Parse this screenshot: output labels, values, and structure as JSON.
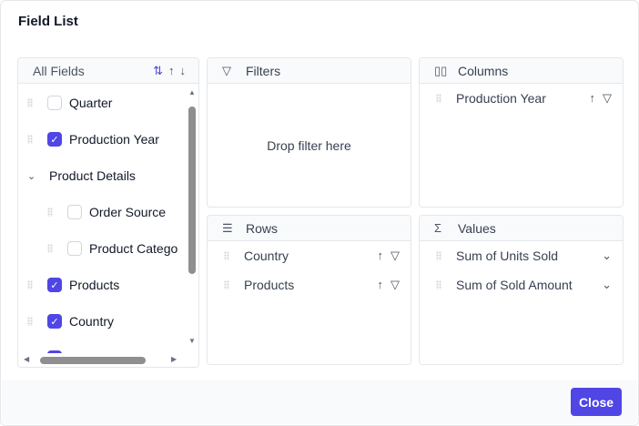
{
  "dialog": {
    "title": "Field List",
    "close_label": "Close"
  },
  "all_fields": {
    "header": "All Fields",
    "items": [
      {
        "label": "Quarter",
        "checked": false,
        "indent": 0
      },
      {
        "label": "Production Year",
        "checked": true,
        "indent": 0
      },
      {
        "label": "Product Details",
        "group": true,
        "indent": 0
      },
      {
        "label": "Order Source",
        "checked": false,
        "indent": 1
      },
      {
        "label": "Product Catego",
        "checked": false,
        "indent": 1
      },
      {
        "label": "Products",
        "checked": true,
        "indent": 0
      },
      {
        "label": "Country",
        "checked": true,
        "indent": 0
      }
    ]
  },
  "filters": {
    "title": "Filters",
    "placeholder": "Drop filter here"
  },
  "columns": {
    "title": "Columns",
    "items": [
      "Production Year"
    ]
  },
  "rows": {
    "title": "Rows",
    "items": [
      "Country",
      "Products"
    ]
  },
  "values": {
    "title": "Values",
    "items": [
      "Sum of Units Sold",
      "Sum of Sold Amount"
    ]
  },
  "colors": {
    "accent": "#4f46e5"
  }
}
